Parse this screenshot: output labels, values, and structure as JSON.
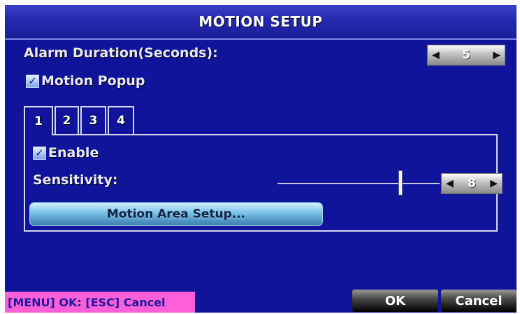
{
  "window": {
    "title": "MOTION SETUP"
  },
  "alarm_duration": {
    "label": "Alarm Duration(Seconds):",
    "value": "5"
  },
  "motion_popup": {
    "label": "Motion Popup",
    "checked": true
  },
  "tabs": [
    {
      "label": "1",
      "active": true
    },
    {
      "label": "2",
      "active": false
    },
    {
      "label": "3",
      "active": false
    },
    {
      "label": "4",
      "active": false
    }
  ],
  "panel": {
    "enable": {
      "label": "Enable",
      "checked": true
    },
    "sensitivity": {
      "label": "Sensitivity:",
      "value": "8",
      "slider_fraction": 0.76
    },
    "area_button_label": "Motion Area Setup..."
  },
  "footer": {
    "hint": "[MENU] OK: [ESC] Cancel",
    "ok_label": "OK",
    "cancel_label": "Cancel"
  },
  "colors": {
    "background": "#10149a",
    "title_bar": "#2328ae",
    "hint_background": "#ff5fd8",
    "button_blue": "#78c0e4"
  },
  "icons": {
    "left_arrow": "left-arrow-icon",
    "right_arrow": "right-arrow-icon",
    "checkmark": "checkmark-icon"
  }
}
